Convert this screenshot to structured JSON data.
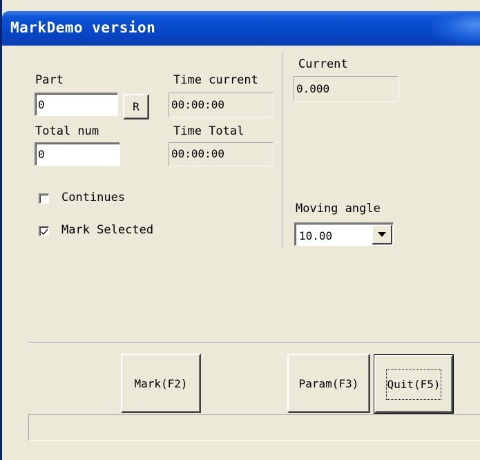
{
  "window": {
    "title": "MarkDemo version"
  },
  "left_panel": {
    "part_label": "Part",
    "part_value": "0",
    "reset_button_label": "R",
    "time_current_label": "Time current",
    "time_current_value": "00:00:00",
    "total_num_label": "Total num",
    "total_num_value": "0",
    "time_total_label": "Time Total",
    "time_total_value": "00:00:00",
    "continues_label": "Continues",
    "continues_checked": false,
    "mark_selected_label": "Mark Selected",
    "mark_selected_checked": true
  },
  "right_panel": {
    "current_label": "Current",
    "current_value": "0.000",
    "moving_angle_label": "Moving angle",
    "moving_angle_value": "10.00"
  },
  "buttons": {
    "mark_label": "Mark(F2)",
    "param_label": "Param(F3)",
    "quit_label": "Quit(F5)"
  },
  "status": {
    "text": ""
  },
  "icons": {
    "check": "checkmark-icon",
    "dropdown": "triangle-down-icon"
  }
}
